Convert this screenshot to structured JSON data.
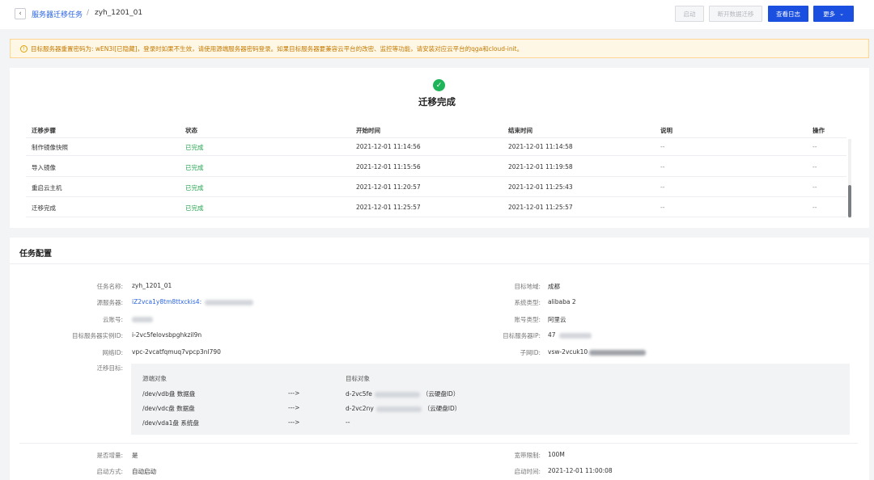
{
  "breadcrumb": {
    "parent": "服务器迁移任务",
    "separator": "/",
    "current": "zyh_1201_01"
  },
  "toolbar": {
    "start": "启动",
    "disconnect": "断开数据迁移",
    "view_log": "查看日志",
    "more": "更多"
  },
  "alert": {
    "text": "目标服务器重置密码为:   wEN3l[已隐藏]，登录时如果不生效，请使用源端服务器密码登录。如果目标服务器要兼容云平台的改密、监控等功能，请安装对应云平台的qga和cloud-init。"
  },
  "status": {
    "title": "迁移完成"
  },
  "steps_table": {
    "headers": [
      "迁移步骤",
      "状态",
      "开始时间",
      "结束时间",
      "说明",
      "操作"
    ],
    "rows": [
      {
        "step": "制作镜像快照",
        "status": "已完成",
        "start": "2021-12-01 11:14:56",
        "end": "2021-12-01 11:14:58",
        "note": "--",
        "op": "--"
      },
      {
        "step": "导入镜像",
        "status": "已完成",
        "start": "2021-12-01 11:15:56",
        "end": "2021-12-01 11:19:58",
        "note": "--",
        "op": "--"
      },
      {
        "step": "重启云主机",
        "status": "已完成",
        "start": "2021-12-01 11:20:57",
        "end": "2021-12-01 11:25:43",
        "note": "--",
        "op": "--"
      },
      {
        "step": "迁移完成",
        "status": "已完成",
        "start": "2021-12-01 11:25:57",
        "end": "2021-12-01 11:25:57",
        "note": "--",
        "op": "--"
      }
    ]
  },
  "config": {
    "title": "任务配置",
    "task_name_label": "任务名称:",
    "task_name": "zyh_1201_01",
    "source_label": "源服务器:",
    "source": "iZ2vca1y8tm8ttxckis4:",
    "cloud_account_label": "云账号:",
    "target_instance_label": "目标服务器实例ID:",
    "target_instance": "i-2vc5felovsbpghkzil9n",
    "network_label": "网络ID:",
    "network": "vpc-2vcatfqmuq7vpcp3nl790",
    "target_region_label": "目标地域:",
    "target_region": "成都",
    "system_type_label": "系统类型:",
    "system_type": "alibaba 2",
    "account_type_label": "账号类型:",
    "account_type": "阿里云",
    "target_ip_label": "目标服务器IP:",
    "target_ip": "47",
    "subnet_label": "子网ID:",
    "subnet": "vsw-2vcuk10",
    "migration_target_label": "迁移目标:",
    "increment_label": "是否增量:",
    "increment": "是",
    "startup_mode_label": "启动方式:",
    "startup_mode": "自动启动",
    "bandwidth_label": "宽带限制:",
    "bandwidth": "100M",
    "startup_time_label": "启动时间:",
    "startup_time": "2021-12-01 11:00:08"
  },
  "migration": {
    "source_header": "源端对象",
    "target_header": "目标对象",
    "rows": [
      {
        "source": "/dev/vdb盘   数据盘",
        "arrow": "--->",
        "target": "d-2vc5fe",
        "target_suffix": "（云硬盘ID）"
      },
      {
        "source": "/dev/vdc盘   数据盘",
        "arrow": "--->",
        "target": "d-2vc2ny",
        "target_suffix": "（云硬盘ID）"
      },
      {
        "source": "/dev/vda1盘   系统盘",
        "arrow": "--->",
        "target": "--",
        "target_suffix": ""
      }
    ]
  }
}
